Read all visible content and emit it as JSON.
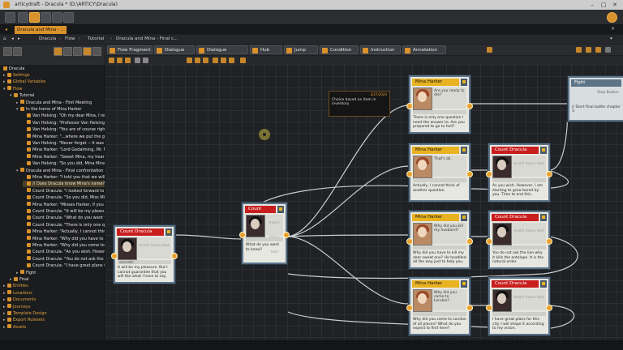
{
  "window": {
    "title": "articydraft - Dracula * (D:\\ARTICY\\Dracula)"
  },
  "doc_tab": {
    "label": "Dracula and Mina - ..."
  },
  "breadcrumb": [
    "Dracula",
    "Flow",
    "Tutorial",
    "Dracula and Mina - Final c..."
  ],
  "palette": {
    "items": [
      {
        "label": "Flow Fragment",
        "color": "#d9922b"
      },
      {
        "label": "Dialogue",
        "color": "#d9922b"
      },
      {
        "label": "Dialogue Fragment",
        "color": "#d9922b"
      },
      {
        "label": "Hub",
        "color": "#d9922b"
      },
      {
        "label": "Jump",
        "color": "#d9922b"
      },
      {
        "label": "Condition",
        "color": "#d9922b"
      },
      {
        "label": "Instruction",
        "color": "#d9922b"
      },
      {
        "label": "Annotation",
        "color": "#d9922b"
      }
    ]
  },
  "tree": {
    "root": "Dracula",
    "items": [
      {
        "label": "Settings",
        "cat": true
      },
      {
        "label": "Global Variables",
        "cat": true
      },
      {
        "label": "Flow",
        "cat": true
      },
      {
        "label": "Tutorial"
      },
      {
        "label": "Dracula and Mina - First Meeting"
      },
      {
        "label": "In the home of Mina Harker"
      },
      {
        "label": "Van Helsing: \"Oh my dear Mina, I really..."
      },
      {
        "label": "Van Helsing: \"Professor Van Helsing, it..."
      },
      {
        "label": "Van Helsing: \"You are of course right. I j..."
      },
      {
        "label": "Mina Harker: \"...where we put the ghoul..."
      },
      {
        "label": "Van Helsing: \"Never forget -- it was not..."
      },
      {
        "label": "Mina Harker: \"Lord Godalming, Mr. Mo..."
      },
      {
        "label": "Mina Harker: \"Sweet Mina, my heart ach..."
      },
      {
        "label": "Van Helsing: \"So you did, Mina Mina..."
      },
      {
        "label": "Dracula and Mina - Final confrontation"
      },
      {
        "label": "Mina Harker: \"I told you that we will me..."
      },
      {
        "label": "// Does Dracula know Mina's name?",
        "sel": true
      },
      {
        "label": "Count Dracula: \"I looked forward to it. I..."
      },
      {
        "label": "Count Dracula: \"So you did, Miss Mina..."
      },
      {
        "label": "Mina Harker: \"Misses Harker, if you ple..."
      },
      {
        "label": "Count Dracula: \"It will be my pleasure. I..."
      },
      {
        "label": "Count Dracula: \"What do you want to k..."
      },
      {
        "label": "Count Dracula: \"There is only one questio..."
      },
      {
        "label": "Mina Harker: \"Actually, I cannot think o..."
      },
      {
        "label": "Mina Harker: \"Why did you have to kill..."
      },
      {
        "label": "Mina Harker: \"Why did you come to Lo..."
      },
      {
        "label": "Count Dracula: \"As you wish. However,..."
      },
      {
        "label": "Count Dracula: \"You do not ask the boo..."
      },
      {
        "label": "Count Dracula: \"I have great plans for t..."
      },
      {
        "label": "Fight"
      },
      {
        "label": "Final"
      },
      {
        "label": "Entities",
        "cat": true
      },
      {
        "label": "Locations",
        "cat": true
      },
      {
        "label": "Documents",
        "cat": true
      },
      {
        "label": "Journeys",
        "cat": true
      },
      {
        "label": "Template Design",
        "cat": true
      },
      {
        "label": "Export Rulesets",
        "cat": true
      },
      {
        "label": "Assets",
        "cat": true
      }
    ]
  },
  "canvas": {
    "note": {
      "date": "2/27/2020",
      "text": "Choice based on item in inventory"
    },
    "cards": [
      {
        "id": "c1",
        "speaker": "Count Dracula",
        "kind": "count",
        "menu": "Insert menu text",
        "sub": "sarcastic",
        "text": "It will be my pleasure. But I cannot guarantee that you will like what I have to say."
      },
      {
        "id": "c2",
        "speaker": "Count Dracula",
        "kind": "count",
        "menu": "Insert menu text",
        "sub": "",
        "text": "What do you want to know?"
      },
      {
        "id": "m1",
        "speaker": "Mina Harker",
        "kind": "mina",
        "menu": "Are you ready to die?",
        "sub": "",
        "text": "There is only one question I need the answer to. Are you prepared to go to hell?"
      },
      {
        "id": "m2",
        "speaker": "Mina Harker",
        "kind": "mina",
        "menu": "That's all.",
        "sub": "",
        "text": "Actually, I cannot think of another question."
      },
      {
        "id": "m3",
        "speaker": "Mina Harker",
        "kind": "mina",
        "menu": "Why did you kill my husband?",
        "sub": "",
        "text": "Why did you have to kill my dear sweet one? He headlled all the way just to help you."
      },
      {
        "id": "m4",
        "speaker": "Mina Harker",
        "kind": "mina",
        "menu": "Why did you come to London?",
        "sub": "",
        "text": "Why did you come to London of all places? What do you expect to find here?"
      },
      {
        "id": "c3",
        "speaker": "Count Dracula",
        "kind": "count",
        "menu": "Insert menu text",
        "sub": "",
        "text": "As you wish. However, I am starting to grow bored by you. Time to end this."
      },
      {
        "id": "c4",
        "speaker": "Count Dracula",
        "kind": "count",
        "menu": "Insert menu text",
        "sub": "",
        "text": "You do not ask the lion why it kills the antelope. It is the natural order."
      },
      {
        "id": "c5",
        "speaker": "Count Dracula",
        "kind": "count",
        "menu": "Insert menu text",
        "sub": "",
        "text": "I have great plans for this city. I will shape it according to my vision."
      }
    ],
    "fight": {
      "title": "Fight",
      "line1": "Stop Button",
      "line2": "// Start final battle chapter 3"
    }
  }
}
